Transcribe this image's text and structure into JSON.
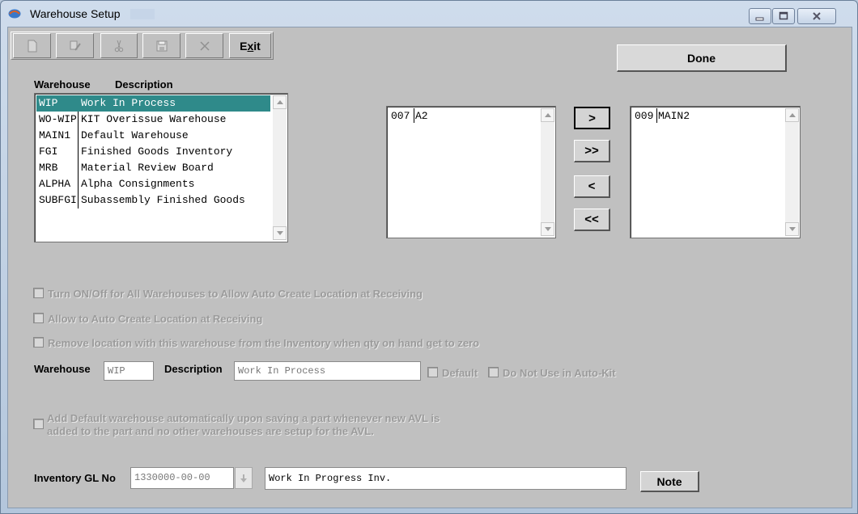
{
  "window": {
    "title": "Warehouse Setup"
  },
  "toolbar": {
    "icons": [
      "new-icon",
      "edit-icon",
      "cut-icon",
      "save-icon",
      "delete-icon"
    ],
    "exit_label": "Exit",
    "exit_hotkey": "x"
  },
  "done_label": "Done",
  "warehouse_list": {
    "header_warehouse": "Warehouse",
    "header_description": "Description",
    "rows": [
      {
        "code": "WIP",
        "description": "Work In Process",
        "selected": true
      },
      {
        "code": "WO-WIP",
        "description": "KIT Overissue Warehouse"
      },
      {
        "code": "MAIN1",
        "description": "Default Warehouse"
      },
      {
        "code": "FGI",
        "description": "Finished Goods Inventory"
      },
      {
        "code": "MRB",
        "description": "Material Review Board"
      },
      {
        "code": "ALPHA",
        "description": "Alpha Consignments"
      },
      {
        "code": "SUBFGI",
        "description": "Subassembly Finished Goods"
      }
    ]
  },
  "left_location_list": {
    "rows": [
      {
        "code": "007",
        "name": "A2"
      }
    ]
  },
  "right_location_list": {
    "rows": [
      {
        "code": "009",
        "name": "MAIN2"
      }
    ]
  },
  "transfer_buttons": {
    "move_one_right": ">",
    "move_all_right": ">>",
    "move_one_left": "<",
    "move_all_left": "<<"
  },
  "checkboxes": {
    "auto_create_all": "Turn ON/Off for All Warehouses to Allow Auto Create Location at Receiving",
    "auto_create": "Allow to Auto Create Location at Receiving",
    "remove_location": "Remove location with this warehouse from the Inventory when qty on hand get to zero",
    "add_default_line1": "Add Default warehouse automatically upon saving a part whenever new AVL is",
    "add_default_line2": "added to the part and no other warehouses are setup for the AVL."
  },
  "detail": {
    "warehouse_label": "Warehouse",
    "warehouse_value": "WIP",
    "description_label": "Description",
    "description_value": "Work In Process",
    "default_label": "Default",
    "do_not_use_label": "Do Not Use in Auto-Kit"
  },
  "gl": {
    "label": "Inventory GL No",
    "number": "1330000-00-00",
    "description": "Work In Progress Inv."
  },
  "note_label": "Note"
}
